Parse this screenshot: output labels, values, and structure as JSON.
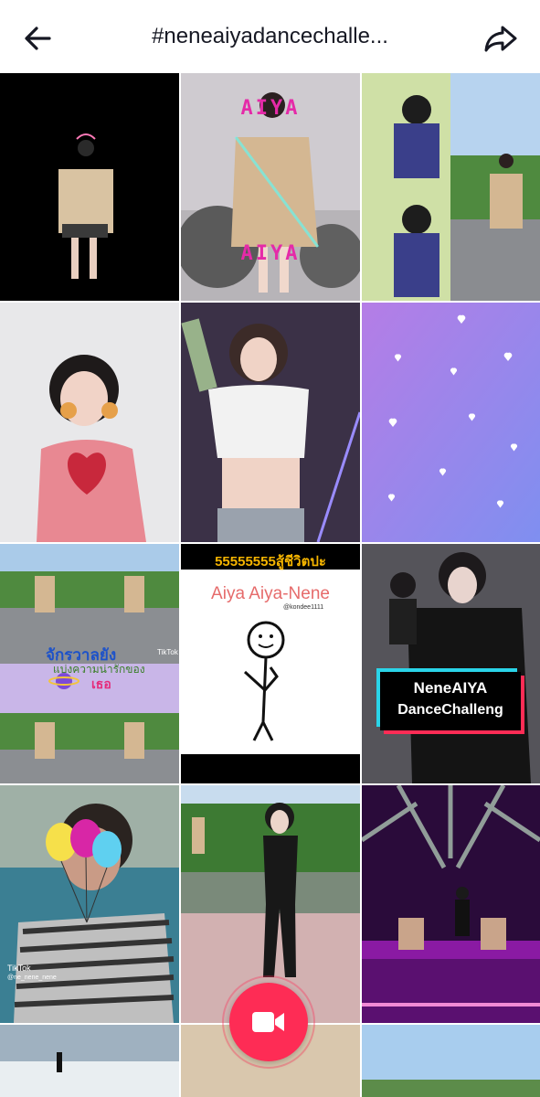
{
  "header": {
    "title": "#neneaiyadancechalle...",
    "back_icon": "arrow-left-icon",
    "share_icon": "share-arrow-icon"
  },
  "tiles": {
    "t2_overlay": "AIYA",
    "t8_top": "55555555สู้ชีวิตปะ",
    "t8_title": "Aiya Aiya-Nene",
    "t8_handle": "@kondee1111",
    "t7_caption1": "จักรวาลยัง",
    "t7_caption2": "แบ่งความน่ารักของ",
    "t7_caption3": "เธอ",
    "t7_watermark": "TikTok",
    "t9_line1": "NeneAIYA",
    "t9_line2": "DanceChalleng",
    "t10_watermark": "TikTok",
    "t10_handle": "@ne_nene_nene"
  },
  "fab": {
    "icon": "video-camera-icon",
    "color": "#fe2c55"
  }
}
